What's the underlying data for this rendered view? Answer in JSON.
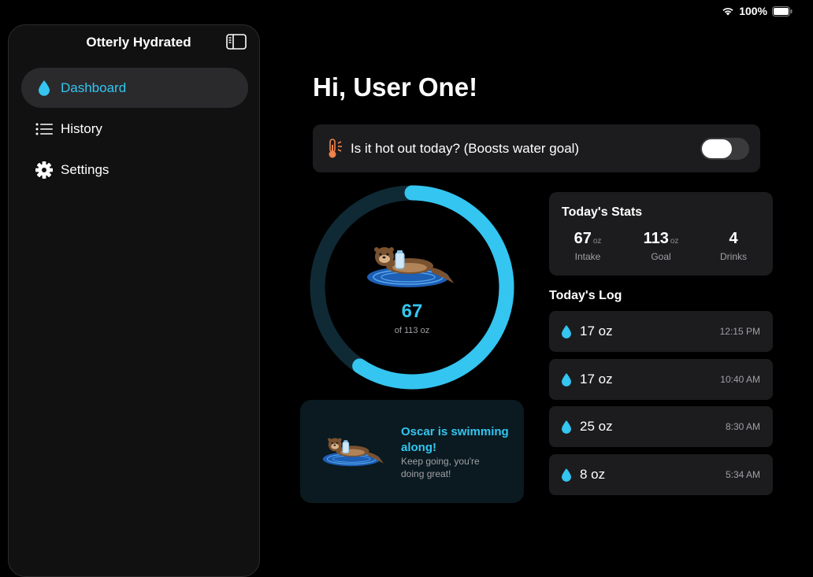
{
  "status": {
    "battery": "100%"
  },
  "app": {
    "title": "Otterly Hydrated"
  },
  "sidebar": {
    "items": [
      {
        "label": "Dashboard",
        "icon": "water-drop-icon",
        "active": true
      },
      {
        "label": "History",
        "icon": "list-icon",
        "active": false
      },
      {
        "label": "Settings",
        "icon": "gear-icon",
        "active": false
      }
    ]
  },
  "main": {
    "greeting": "Hi, User One!",
    "hot_toggle": {
      "label": "Is it hot out today? (Boosts water goal)",
      "on": false
    },
    "progress": {
      "value": "67",
      "sub": "of 113 oz",
      "fraction": 0.593
    },
    "oscar": {
      "title": "Oscar is swimming along!",
      "subtitle": "Keep going, you're doing great!"
    },
    "stats": {
      "title": "Today's Stats",
      "items": [
        {
          "value": "67",
          "unit": "oz",
          "label": "Intake"
        },
        {
          "value": "113",
          "unit": "oz",
          "label": "Goal"
        },
        {
          "value": "4",
          "unit": "",
          "label": "Drinks"
        }
      ]
    },
    "log": {
      "title": "Today's Log",
      "entries": [
        {
          "amount": "17 oz",
          "time": "12:15 PM"
        },
        {
          "amount": "17 oz",
          "time": "10:40 AM"
        },
        {
          "amount": "25 oz",
          "time": "8:30 AM"
        },
        {
          "amount": "8 oz",
          "time": "5:34 AM"
        }
      ]
    }
  },
  "colors": {
    "accent": "#34c5f0",
    "track": "#0f2a35",
    "card": "#1c1c1e",
    "oscar_card": "#0a1a20"
  }
}
